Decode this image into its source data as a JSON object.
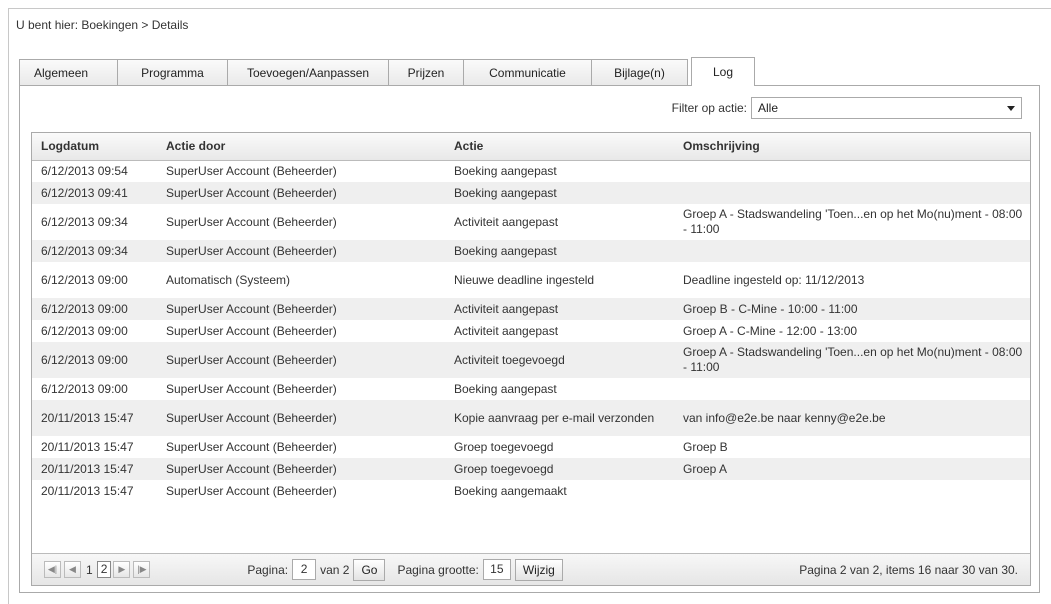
{
  "breadcrumb": "U bent hier: Boekingen > Details",
  "tabs": [
    {
      "label": "Algemeen"
    },
    {
      "label": "Programma"
    },
    {
      "label": "Toevoegen/Aanpassen"
    },
    {
      "label": "Prijzen"
    },
    {
      "label": "Communicatie"
    },
    {
      "label": "Bijlage(n)"
    },
    {
      "label": "Log",
      "active": true
    }
  ],
  "filter": {
    "label": "Filter op actie:",
    "value": "Alle"
  },
  "columns": [
    "Logdatum",
    "Actie door",
    "Actie",
    "Omschrijving"
  ],
  "rows": [
    [
      "6/12/2013 09:54",
      "SuperUser Account (Beheerder)",
      "Boeking aangepast",
      ""
    ],
    [
      "6/12/2013 09:41",
      "SuperUser Account (Beheerder)",
      "Boeking aangepast",
      ""
    ],
    [
      "6/12/2013 09:34",
      "SuperUser Account (Beheerder)",
      "Activiteit aangepast",
      "Groep A - Stadswandeling 'Toen...en op het Mo(nu)ment - 08:00 - 11:00"
    ],
    [
      "6/12/2013 09:34",
      "SuperUser Account (Beheerder)",
      "Boeking aangepast",
      ""
    ],
    [
      "6/12/2013 09:00",
      "Automatisch (Systeem)",
      "Nieuwe deadline ingesteld",
      "Deadline ingesteld op: 11/12/2013"
    ],
    [
      "6/12/2013 09:00",
      "SuperUser Account (Beheerder)",
      "Activiteit aangepast",
      "Groep B - C-Mine - 10:00 - 11:00"
    ],
    [
      "6/12/2013 09:00",
      "SuperUser Account (Beheerder)",
      "Activiteit aangepast",
      "Groep A - C-Mine - 12:00 - 13:00"
    ],
    [
      "6/12/2013 09:00",
      "SuperUser Account (Beheerder)",
      "Activiteit toegevoegd",
      "Groep A - Stadswandeling 'Toen...en op het Mo(nu)ment - 08:00 - 11:00"
    ],
    [
      "6/12/2013 09:00",
      "SuperUser Account (Beheerder)",
      "Boeking aangepast",
      ""
    ],
    [
      "20/11/2013 15:47",
      "SuperUser Account (Beheerder)",
      "Kopie aanvraag per e-mail verzonden",
      "van info@e2e.be naar kenny@e2e.be"
    ],
    [
      "20/11/2013 15:47",
      "SuperUser Account (Beheerder)",
      "Groep toegevoegd",
      "Groep B"
    ],
    [
      "20/11/2013 15:47",
      "SuperUser Account (Beheerder)",
      "Groep toegevoegd",
      "Groep A"
    ],
    [
      "20/11/2013 15:47",
      "SuperUser Account (Beheerder)",
      "Boeking aangemaakt",
      ""
    ]
  ],
  "pager": {
    "page_links": [
      "1",
      "2"
    ],
    "current_page": "2",
    "page_label": "Pagina:",
    "page_value": "2",
    "of_label": "van 2",
    "go_label": "Go",
    "size_label": "Pagina grootte:",
    "size_value": "15",
    "change_label": "Wijzig",
    "summary": "Pagina 2 van 2, items 16 naar 30 van 30."
  }
}
